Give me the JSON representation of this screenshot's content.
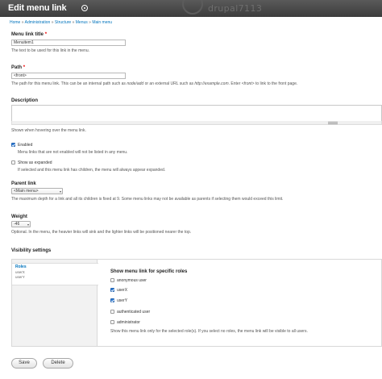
{
  "header": {
    "title": "Edit menu link",
    "watermark": "drupal7113"
  },
  "breadcrumb": [
    "Home",
    "Administration",
    "Structure",
    "Menus",
    "Main menu"
  ],
  "form": {
    "title_label": "Menu link title",
    "required_mark": "*",
    "title_value": "Menuitem1",
    "title_desc": "The text to be used for this link in the menu.",
    "path_label": "Path",
    "path_value": "<front>",
    "path_desc_1": "The path for this menu link. This can be an internal path such as ",
    "path_desc_2": "node/add",
    "path_desc_3": " or an external URL such as ",
    "path_desc_4": "http://example.com",
    "path_desc_5": ". Enter ",
    "path_desc_6": "<front>",
    "path_desc_7": " to link to the front page.",
    "description_label": "Description",
    "description_desc": "Shown when hovering over the menu link.",
    "enabled_label": "Enabled",
    "enabled_checked": true,
    "enabled_desc": "Menu links that are not enabled will not be listed in any menu.",
    "expanded_label": "Show as expanded",
    "expanded_checked": false,
    "expanded_desc": "If selected and this menu link has children, the menu will always appear expanded.",
    "parent_label": "Parent link",
    "parent_value": "<Main menu>",
    "parent_desc": "The maximum depth for a link and all its children is fixed at 9. Some menu links may not be available as parents if selecting them would exceed this limit.",
    "weight_label": "Weight",
    "weight_value": "-46",
    "weight_desc": "Optional. In the menu, the heavier links will sink and the lighter links will be positioned nearer the top."
  },
  "visibility": {
    "title": "Visibility settings",
    "tab_title": "Roles",
    "tab_summary": [
      "userX",
      "userY"
    ],
    "pane_title": "Show menu link for specific roles",
    "roles": [
      {
        "label": "anonymous user",
        "checked": false
      },
      {
        "label": "userX",
        "checked": true
      },
      {
        "label": "userY",
        "checked": true
      },
      {
        "label": "authenticated user",
        "checked": false
      },
      {
        "label": "administrator",
        "checked": false
      }
    ],
    "pane_desc": "Show this menu link only for the selected role(s). If you select no roles, the menu link will be visible to all users."
  },
  "actions": {
    "save_label": "Save",
    "delete_label": "Delete"
  },
  "colors": {
    "header_bg": "#3c3c3c",
    "link": "#0074bd",
    "checkbox_checked": "#2b7bd6"
  }
}
